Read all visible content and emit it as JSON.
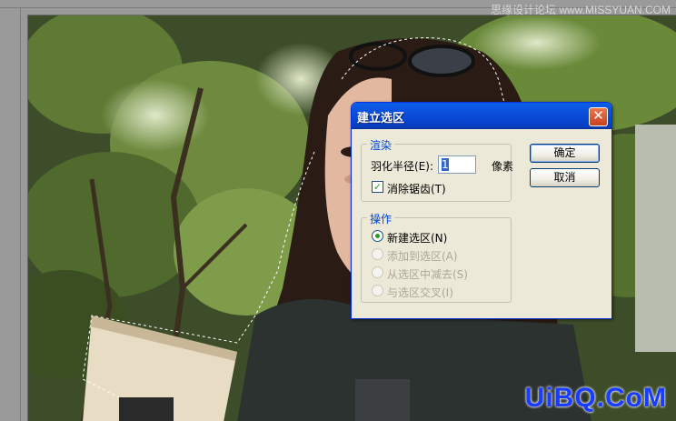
{
  "watermark_top": "思缘设计论坛 www.MISSYUAN.COM",
  "watermark_bottom": "UiBQ.CoM",
  "dialog": {
    "title": "建立选区",
    "close_symbol": "✕",
    "render_group": {
      "legend": "渲染",
      "feather_label": "羽化半径(E):",
      "feather_value": "1",
      "feather_unit": "像素",
      "antialias_label": "消除锯齿(T)",
      "antialias_checked": true
    },
    "operation_group": {
      "legend": "操作",
      "options": [
        {
          "label": "新建选区(N)",
          "selected": true,
          "enabled": true
        },
        {
          "label": "添加到选区(A)",
          "selected": false,
          "enabled": false
        },
        {
          "label": "从选区中减去(S)",
          "selected": false,
          "enabled": false
        },
        {
          "label": "与选区交叉(I)",
          "selected": false,
          "enabled": false
        }
      ]
    },
    "ok_label": "确定",
    "cancel_label": "取消"
  },
  "colors": {
    "titlebar": "#0b4fdc",
    "dialog_bg": "#ece9d8",
    "watermark_blue": "#1a3cff"
  }
}
